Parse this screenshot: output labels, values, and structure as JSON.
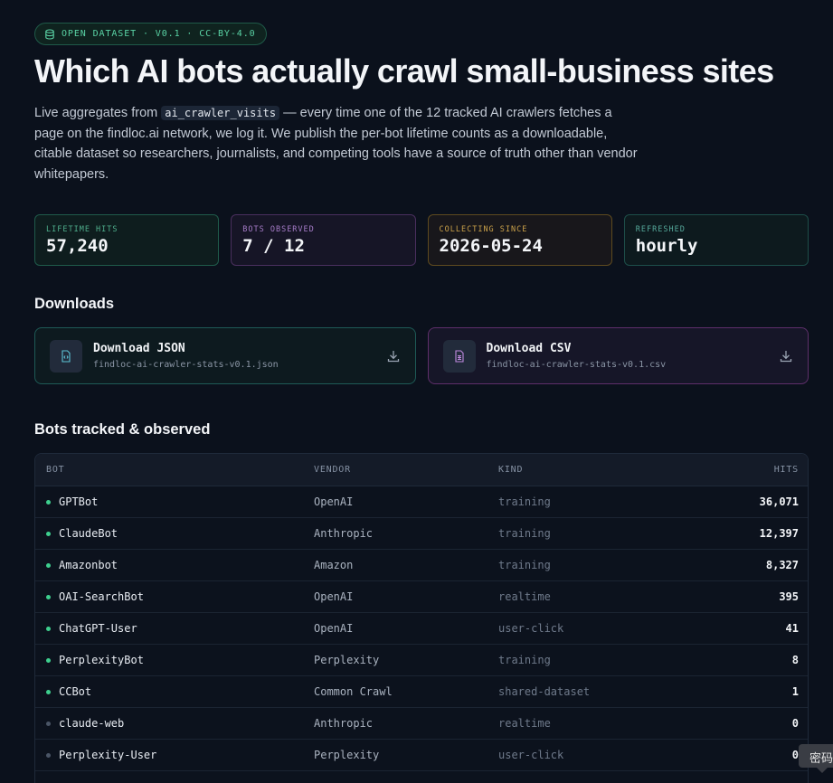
{
  "badge": {
    "text": "OPEN DATASET · V0.1 · CC-BY-4.0"
  },
  "header": {
    "title": "Which AI bots actually crawl small-business sites",
    "intro_before": "Live aggregates from ",
    "intro_code": "ai_crawler_visits",
    "intro_after": " — every time one of the 12 tracked AI crawlers fetches a page on the findloc.ai network, we log it. We publish the per-bot lifetime counts as a downloadable, citable dataset so researchers, journalists, and competing tools have a source of truth other than vendor whitepapers."
  },
  "stats": [
    {
      "label": "LIFETIME HITS",
      "value": "57,240"
    },
    {
      "label": "BOTS OBSERVED",
      "value": "7 / 12"
    },
    {
      "label": "COLLECTING SINCE",
      "value": "2026-05-24"
    },
    {
      "label": "REFRESHED",
      "value": "hourly"
    }
  ],
  "downloads": {
    "heading": "Downloads",
    "json": {
      "title": "Download JSON",
      "file": "findloc-ai-crawler-stats-v0.1.json"
    },
    "csv": {
      "title": "Download CSV",
      "file": "findloc-ai-crawler-stats-v0.1.csv"
    }
  },
  "bots": {
    "heading": "Bots tracked & observed",
    "columns": {
      "bot": "BOT",
      "vendor": "VENDOR",
      "kind": "KIND",
      "hits": "HITS"
    },
    "rows": [
      {
        "bot": "GPTBot",
        "vendor": "OpenAI",
        "kind": "training",
        "hits": "36,071",
        "active": true
      },
      {
        "bot": "ClaudeBot",
        "vendor": "Anthropic",
        "kind": "training",
        "hits": "12,397",
        "active": true
      },
      {
        "bot": "Amazonbot",
        "vendor": "Amazon",
        "kind": "training",
        "hits": "8,327",
        "active": true
      },
      {
        "bot": "OAI-SearchBot",
        "vendor": "OpenAI",
        "kind": "realtime",
        "hits": "395",
        "active": true
      },
      {
        "bot": "ChatGPT-User",
        "vendor": "OpenAI",
        "kind": "user-click",
        "hits": "41",
        "active": true
      },
      {
        "bot": "PerplexityBot",
        "vendor": "Perplexity",
        "kind": "training",
        "hits": "8",
        "active": true
      },
      {
        "bot": "CCBot",
        "vendor": "Common Crawl",
        "kind": "shared-dataset",
        "hits": "1",
        "active": true
      },
      {
        "bot": "claude-web",
        "vendor": "Anthropic",
        "kind": "realtime",
        "hits": "0",
        "active": false
      },
      {
        "bot": "Perplexity-User",
        "vendor": "Perplexity",
        "kind": "user-click",
        "hits": "0",
        "active": false
      }
    ]
  },
  "tooltip": {
    "text": "密码"
  },
  "colors": {
    "background": "#0b111c",
    "accent_green": "#3ecf8e",
    "accent_purple": "#a57bc7",
    "accent_amber": "#c9a049"
  },
  "icons": {
    "badge": "database-icon",
    "json": "json-file-icon",
    "csv": "csv-file-icon",
    "download": "download-icon"
  }
}
